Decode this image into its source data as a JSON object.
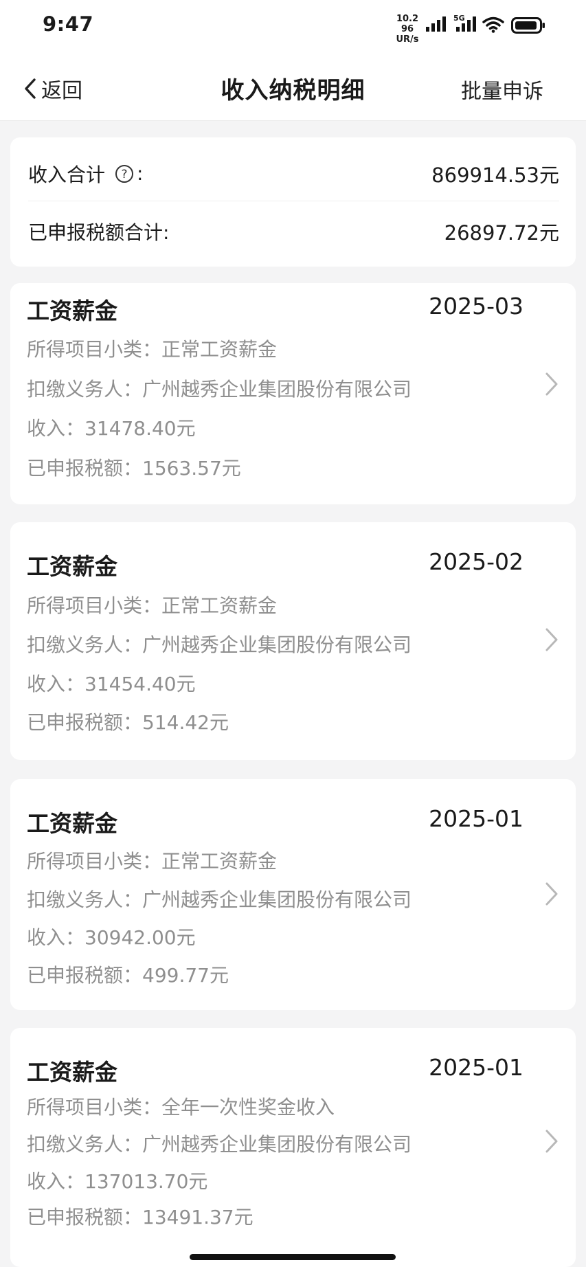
{
  "status_bar": {
    "time": "9:47",
    "net_speed_top": "10.2 96",
    "net_speed_bottom": "UR/s",
    "sim_label": "5G"
  },
  "nav": {
    "back_label": "返回",
    "title": "收入纳税明细",
    "batch_appeal_label": "批量申诉"
  },
  "summary": {
    "income_label": "收入合计",
    "income_suffix": ":",
    "income_value": "869914.53元",
    "tax_label": "已申报税额合计:",
    "tax_value": "26897.72元"
  },
  "records": [
    {
      "title": "工资薪金",
      "date": "2025-03",
      "subcategory": "所得项目小类：正常工资薪金",
      "withholder": "扣缴义务人：广州越秀企业集团股份有限公司",
      "income": "收入：31478.40元",
      "tax": "已申报税额：1563.57元"
    },
    {
      "title": "工资薪金",
      "date": "2025-02",
      "subcategory": "所得项目小类：正常工资薪金",
      "withholder": "扣缴义务人：广州越秀企业集团股份有限公司",
      "income": "收入：31454.40元",
      "tax": "已申报税额：514.42元"
    },
    {
      "title": "工资薪金",
      "date": "2025-01",
      "subcategory": "所得项目小类：正常工资薪金",
      "withholder": "扣缴义务人：广州越秀企业集团股份有限公司",
      "income": "收入：30942.00元",
      "tax": "已申报税额：499.77元"
    },
    {
      "title": "工资薪金",
      "date": "2025-01",
      "subcategory": "所得项目小类：全年一次性奖金收入",
      "withholder": "扣缴义务人：广州越秀企业集团股份有限公司",
      "income": "收入：137013.70元",
      "tax": "已申报税额：13491.37元"
    }
  ],
  "colors": {
    "background": "#f4f4f5",
    "card": "#ffffff",
    "primary_text": "#1a1a1a",
    "secondary_text": "#8f8f8f",
    "chevron": "#b8b8b8"
  }
}
